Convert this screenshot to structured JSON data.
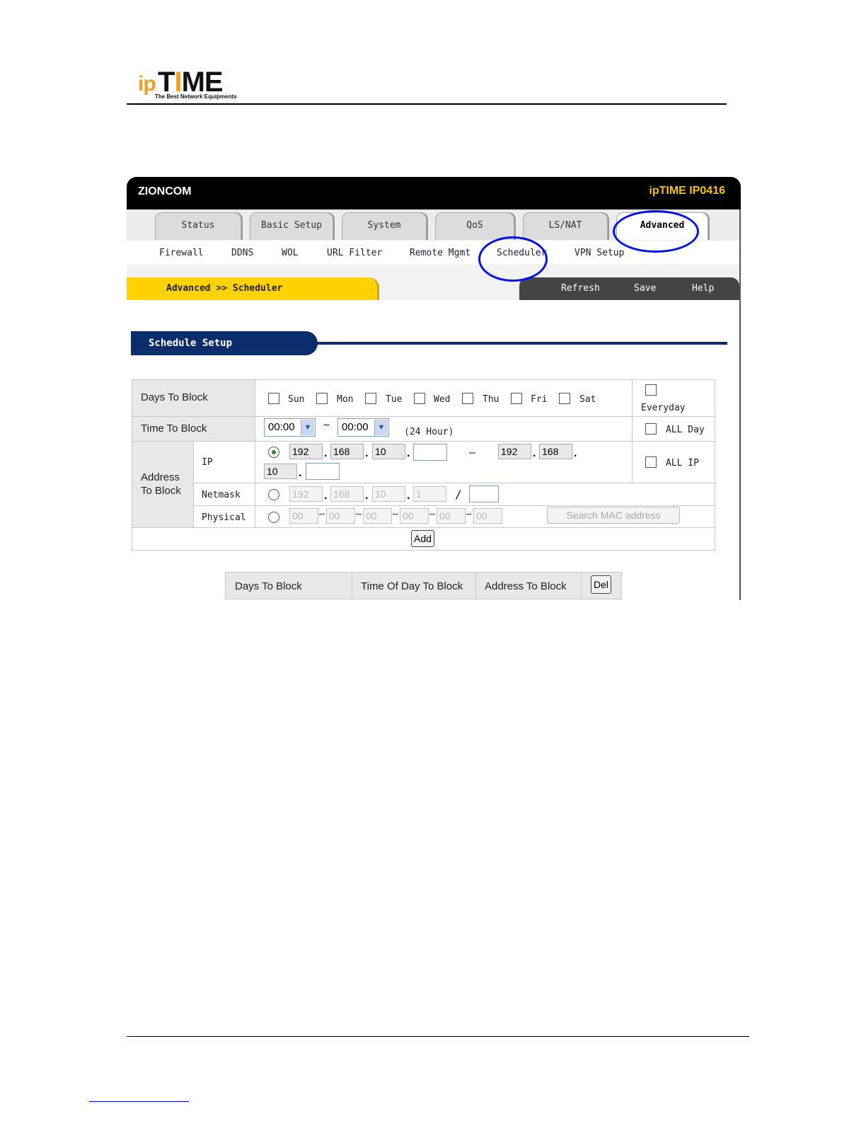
{
  "logo": {
    "ip": "ip",
    "time_t": "T",
    "time_i": "I",
    "time_me": "ME",
    "tagline": "The Best Network Equipments"
  },
  "window": {
    "brand": "ZIONCOM",
    "model": "ipTIME IP0416",
    "tabs": [
      "Status",
      "Basic Setup",
      "System",
      "QoS",
      "LS/NAT",
      "Advanced"
    ],
    "active_tab": "Advanced",
    "subnav": [
      "Firewall",
      "DDNS",
      "WOL",
      "URL Filter",
      "Remote Mgmt",
      "Scheduler",
      "VPN Setup"
    ],
    "breadcrumb": "Advanced >> Scheduler",
    "actions": [
      "Refresh",
      "Save",
      "Help"
    ]
  },
  "section_title": "Schedule Setup",
  "form": {
    "days_label": "Days To Block",
    "days": [
      "Sun",
      "Mon",
      "Tue",
      "Wed",
      "Thu",
      "Fri",
      "Sat"
    ],
    "everyday_label": "Everyday",
    "time_label": "Time To Block",
    "time_from": "00:00",
    "time_sep": "~",
    "time_to": "00:00",
    "time_hint": "(24 Hour)",
    "allday_label": "ALL Day",
    "address_label_1": "Address",
    "address_label_2": "To Block",
    "ip_label": "IP",
    "ip_start": [
      "192",
      "168",
      "10",
      ""
    ],
    "ip_dash": "–",
    "ip_end": [
      "192",
      "168",
      "10",
      ""
    ],
    "allip_label": "ALL IP",
    "netmask_label": "Netmask",
    "netmask_ip": [
      "192",
      "168",
      "10",
      "1"
    ],
    "netmask_slash": "/",
    "netmask_bits": "",
    "physical_label": "Physical",
    "mac": [
      "00",
      "00",
      "00",
      "00",
      "00",
      "00"
    ],
    "search_mac_button": "Search MAC address",
    "add_button": "Add"
  },
  "result_table": {
    "headers": [
      "Days To Block",
      "Time Of Day To Block",
      "Address To Block"
    ],
    "del_button": "Del"
  },
  "colors": {
    "accent_yellow": "#ffd200",
    "section_blue": "#0c2d6b",
    "annotation_circle": "#0010ee",
    "logo_orange": "#f0a020"
  }
}
